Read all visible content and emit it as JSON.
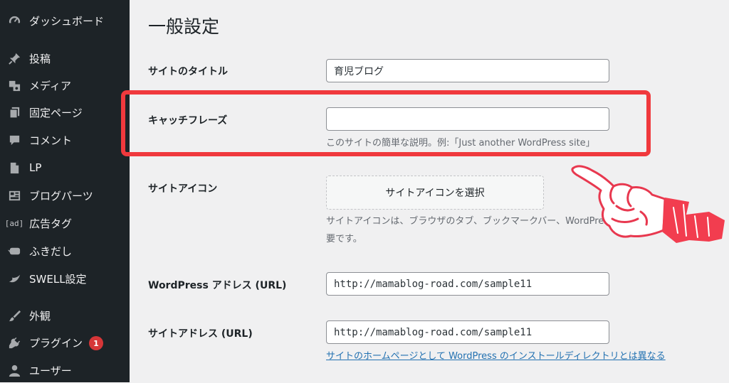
{
  "sidebar": {
    "items": [
      {
        "label": "ダッシュボード",
        "icon": "dashboard-icon"
      },
      {
        "label": "投稿",
        "icon": "pin-icon"
      },
      {
        "label": "メディア",
        "icon": "media-icon"
      },
      {
        "label": "固定ページ",
        "icon": "page-icon"
      },
      {
        "label": "コメント",
        "icon": "comment-icon"
      },
      {
        "label": "LP",
        "icon": "document-icon"
      },
      {
        "label": "ブログパーツ",
        "icon": "layout-icon"
      },
      {
        "label": "広告タグ",
        "icon": "ad-icon",
        "icon_text": "[ad]"
      },
      {
        "label": "ふきだし",
        "icon": "speech-bubble-icon"
      },
      {
        "label": "SWELL設定",
        "icon": "swell-icon"
      },
      {
        "label": "外観",
        "icon": "brush-icon"
      },
      {
        "label": "プラグイン",
        "icon": "plugin-icon",
        "badge": "1"
      },
      {
        "label": "ユーザー",
        "icon": "user-icon"
      }
    ]
  },
  "main": {
    "title": "一般設定",
    "site_title": {
      "label": "サイトのタイトル",
      "value": "育児ブログ"
    },
    "tagline": {
      "label": "キャッチフレーズ",
      "value": "",
      "description": "このサイトの簡単な説明。例:「Just another WordPress site」"
    },
    "site_icon": {
      "label": "サイトアイコン",
      "button": "サイトアイコンを選択",
      "description_line1": "サイトアイコンは、ブラウザのタブ、ブックマークバー、WordPress モバイルア",
      "description_line2": "要です。"
    },
    "wp_address": {
      "label": "WordPress アドレス (URL)",
      "value": "http://mamablog-road.com/sample11"
    },
    "site_address": {
      "label": "サイトアドレス (URL)",
      "value": "http://mamablog-road.com/sample11",
      "link": "サイトのホームページとして WordPress のインストールディレクトリとは異なる"
    }
  },
  "colors": {
    "sidebar_bg": "#1d2327",
    "content_bg": "#f0f0f1",
    "highlight": "#f0393d",
    "link": "#2271b1",
    "badge": "#d63638"
  }
}
